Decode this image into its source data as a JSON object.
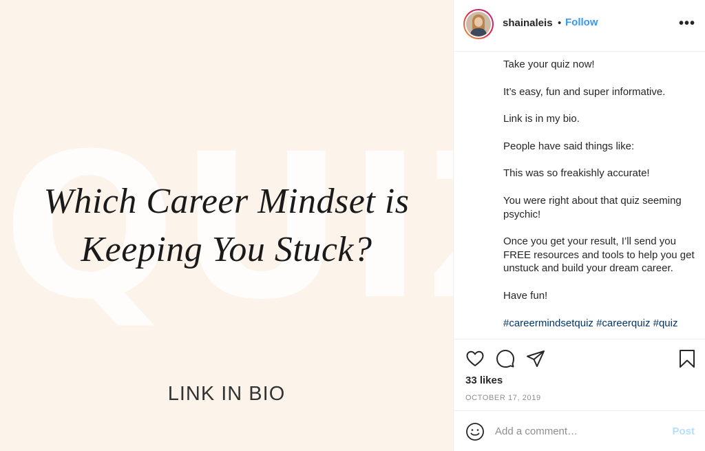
{
  "image": {
    "background_word": "QUIZ",
    "headline_line1": "Which Career Mindset is",
    "headline_line2": "Keeping You Stuck?",
    "footer_text": "LINK IN BIO",
    "background_color": "#fcf3eb"
  },
  "header": {
    "username": "shainaleis",
    "separator": "•",
    "follow_label": "Follow",
    "more_label": "•••"
  },
  "caption": {
    "paragraphs": [
      "Take your quiz now!",
      "It’s easy, fun and super informative.",
      "Link is in my bio.",
      "People have said things like:",
      "This was so freakishly accurate!",
      "You were right about that quiz seeming psychic!",
      "Once you get your result, I’ll send you FREE resources and tools to help you get unstuck and build your dream career.",
      "Have fun!"
    ],
    "hashtags": "#careermindsetquiz #careerquiz #quiz"
  },
  "actions": {
    "icons": [
      "heart-icon",
      "comment-icon",
      "share-icon",
      "bookmark-icon"
    ],
    "likes": "33 likes",
    "date": "OCTOBER 17, 2019"
  },
  "comment": {
    "placeholder": "Add a comment…",
    "post_label": "Post"
  },
  "colors": {
    "follow": "#3897f0",
    "post_disabled": "#b2dffc",
    "hashtag": "#003569"
  }
}
